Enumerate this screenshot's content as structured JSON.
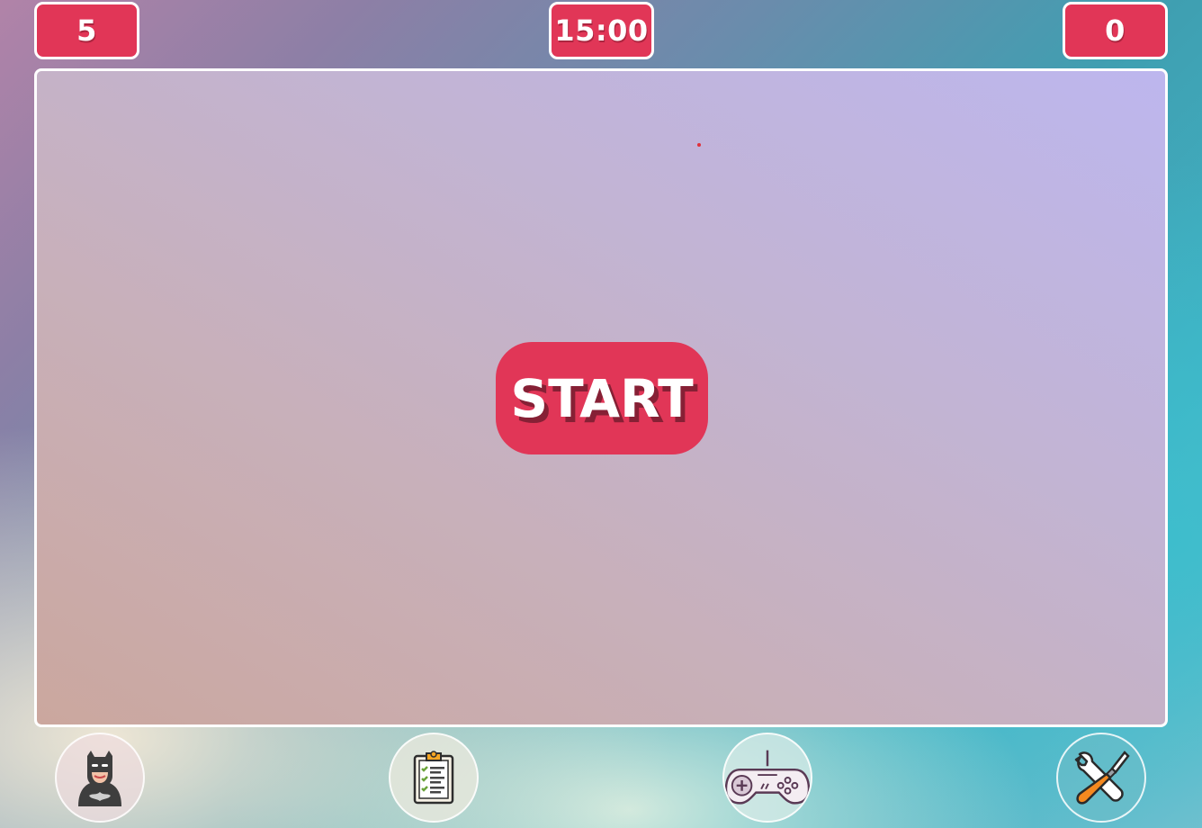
{
  "hud": {
    "lives": "5",
    "timer": "15:00",
    "score": "0"
  },
  "arena": {
    "start_label": "START"
  },
  "bottom_nav": {
    "items": [
      {
        "icon": "batman-avatar-icon"
      },
      {
        "icon": "clipboard-checklist-icon"
      },
      {
        "icon": "gamepad-icon"
      },
      {
        "icon": "tools-icon"
      }
    ]
  },
  "colors": {
    "accent": "#e13657",
    "border": "#ffffff"
  }
}
